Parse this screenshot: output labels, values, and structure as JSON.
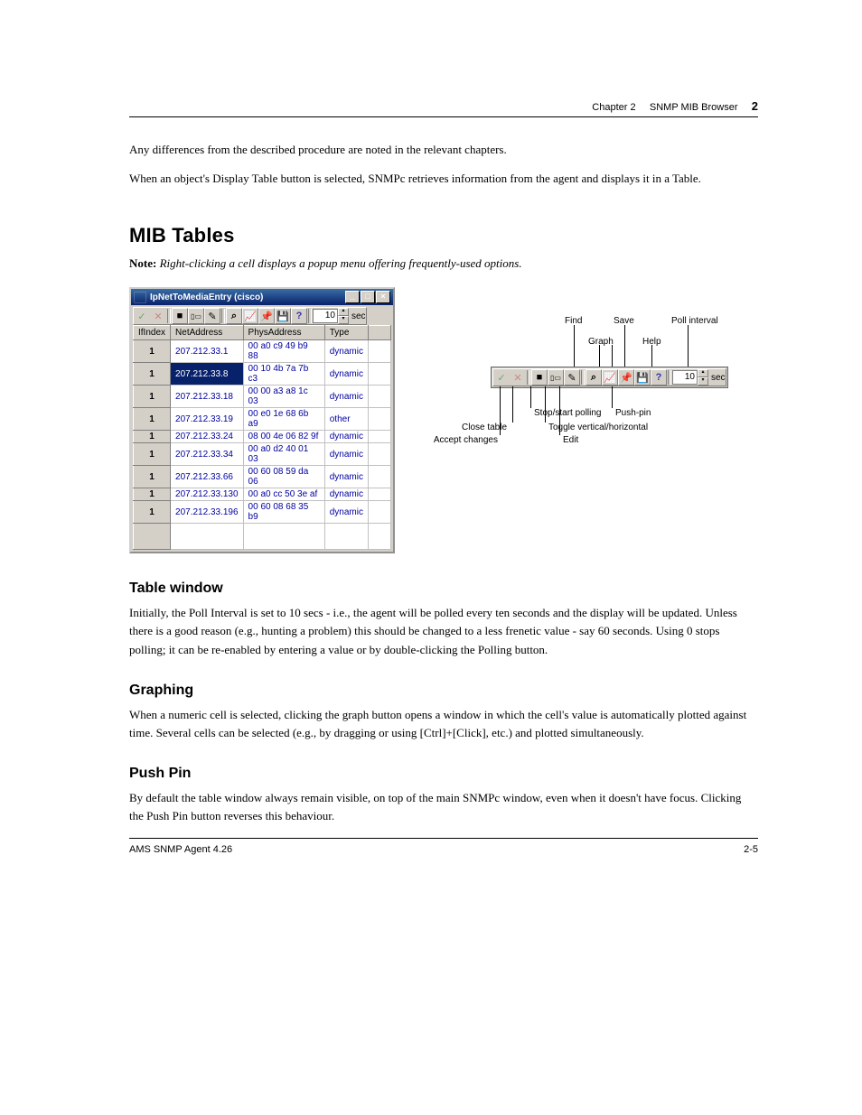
{
  "header": {
    "chapter_label": "Chapter 2",
    "chapter_title": "SNMP MIB Browser",
    "chapnum_display": "2"
  },
  "intro": {
    "p1": "Any differences from the described procedure are noted in the relevant chapters.",
    "p2": "When an object's Display Table button is selected, SNMPc retrieves information from the agent and displays it in a Table."
  },
  "mib_tables_heading": "MIB Tables",
  "table_note": "Right-clicking a cell displays a popup menu offering frequently-used options.",
  "window": {
    "title": "IpNetToMediaEntry (cisco)",
    "columns": [
      "IfIndex",
      "NetAddress",
      "PhysAddress",
      "Type"
    ],
    "rows": [
      {
        "ifindex": "1",
        "net": "207.212.33.1",
        "phys": "00 a0 c9 49 b9 88",
        "type": "dynamic",
        "selected": false
      },
      {
        "ifindex": "1",
        "net": "207.212.33.8",
        "phys": "00 10 4b 7a 7b c3",
        "type": "dynamic",
        "selected": true
      },
      {
        "ifindex": "1",
        "net": "207.212.33.18",
        "phys": "00 00 a3 a8 1c 03",
        "type": "dynamic",
        "selected": false
      },
      {
        "ifindex": "1",
        "net": "207.212.33.19",
        "phys": "00 e0 1e 68 6b a9",
        "type": "other",
        "selected": false
      },
      {
        "ifindex": "1",
        "net": "207.212.33.24",
        "phys": "08 00 4e 06 82 9f",
        "type": "dynamic",
        "selected": false
      },
      {
        "ifindex": "1",
        "net": "207.212.33.34",
        "phys": "00 a0 d2 40 01 03",
        "type": "dynamic",
        "selected": false
      },
      {
        "ifindex": "1",
        "net": "207.212.33.66",
        "phys": "00 60 08 59 da 06",
        "type": "dynamic",
        "selected": false
      },
      {
        "ifindex": "1",
        "net": "207.212.33.130",
        "phys": "00 a0 cc 50 3e af",
        "type": "dynamic",
        "selected": false
      },
      {
        "ifindex": "1",
        "net": "207.212.33.196",
        "phys": "00 60 08 68 35 b9",
        "type": "dynamic",
        "selected": false
      }
    ]
  },
  "toolbar": {
    "accept_tip": "✓",
    "close_tip": "✕",
    "stop_tip": "■",
    "toggle_vh_tip": "▮▬",
    "edit_tip": "✎",
    "find_tip": "⌕",
    "graph_tip": "↗",
    "pushpin_tip": "📍",
    "save_tip": "💾",
    "help_tip": "?",
    "poll_value": "10",
    "sec_label": "sec"
  },
  "anno_labels": {
    "accept_changes": "Accept changes",
    "close_table": "Close table",
    "stop_polling": "Stop/start polling",
    "toggle_vh": "Toggle vertical/horizontal",
    "edit": "Edit",
    "save": "Save",
    "find": "Find",
    "help": "Help",
    "graph": "Graph",
    "pushpin": "Push-pin",
    "poll_interval": "Poll interval"
  },
  "right_col": {
    "heading": "Table window",
    "body": "Initially, the Poll Interval is set to 10 secs - i.e., the agent will be polled every ten seconds and the display will be updated. Unless there is a good reason (e.g., hunting a problem) this should be changed to a less frenetic value - say 60 seconds. Using 0 stops polling; it can be re-enabled by entering a value or by double-clicking the Polling button."
  },
  "subs": {
    "graph_heading": "Graphing",
    "graph_body": "When a numeric cell is selected, clicking the graph button opens a window in which the cell's value is automatically plotted against time. Several cells can be selected (e.g., by dragging or using [Ctrl]+[Click], etc.) and plotted simultaneously.",
    "pin_heading": "Push Pin",
    "pin_body": "By default the table window always remain visible, on top of the main SNMPc window, even when it doesn't have focus. Clicking the Push Pin button reverses this behaviour."
  },
  "footer": {
    "doc_id": "AMS SNMP Agent 4.26",
    "page_num": "2-5"
  }
}
